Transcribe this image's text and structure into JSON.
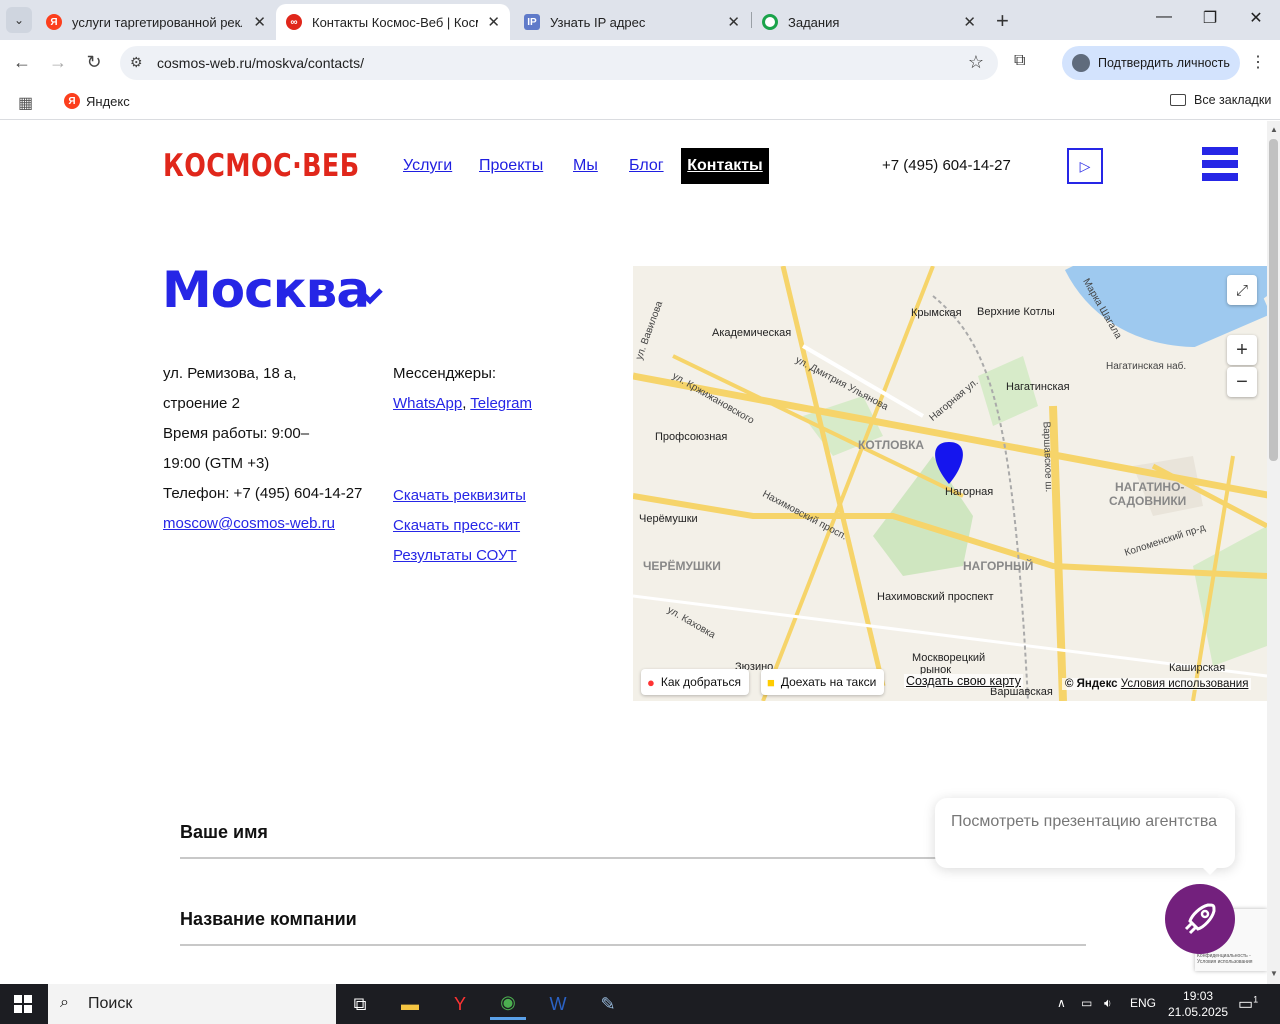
{
  "browser": {
    "tabs": [
      {
        "title": "услуги таргетированной рекла",
        "favicon": "yandex-icon",
        "color": "#fc3f1d",
        "active": false
      },
      {
        "title": "Контакты Космос-Веб | Космо",
        "favicon": "cosmos-web-icon",
        "color": "#e0271b",
        "active": true
      },
      {
        "title": "Узнать IP адрес",
        "favicon": "ip-icon",
        "color": "#5f7ac9",
        "active": false
      },
      {
        "title": "Задания",
        "favicon": "tasks-icon",
        "color": "#1aa34a",
        "active": false
      }
    ],
    "url": "cosmos-web.ru/moskva/contacts/",
    "verify_label": "Подтвердить личность",
    "bookmarks": {
      "yandex": "Яндекс",
      "all": "Все закладки"
    }
  },
  "site": {
    "logo": "КОСМОС·ВЕБ",
    "menu": [
      "Услуги",
      "Проекты",
      "Мы",
      "Блог"
    ],
    "menu_active": "Контакты",
    "phone": "+7 (495) 604-14-27",
    "colors": {
      "brand": "#e0271b",
      "accent": "#2626e6"
    }
  },
  "contacts": {
    "city": "Москва",
    "address_line1": "ул. Ремизова, 18 а,",
    "address_line2": "строение 2",
    "hours_line1": "Время работы: 9:00–",
    "hours_line2": "19:00 (GTM +3)",
    "phone_line": "Телефон: +7 (495) 604-14-27",
    "email": "moscow@cosmos-web.ru",
    "messengers_label": "Мессенджеры:",
    "whatsapp": "WhatsApp",
    "comma": ",",
    "telegram": "Telegram",
    "links": [
      "Скачать реквизиты",
      "Скачать пресс-кит",
      "Результаты СОУТ"
    ]
  },
  "map": {
    "labels": {
      "akademicheskaya": "Академическая",
      "krymskaya": "Крымская",
      "verkhnie_kotly": "Верхние Котлы",
      "nagatinskaya": "Нагатинская",
      "nagatinskaya_nab": "Нагатинская наб.",
      "profsoyuznaya": "Профсоюзная",
      "kotlovka": "КОТЛОВКА",
      "nagornaya": "Нагорная",
      "nagatino": "НАГАТИНО-",
      "sadovniki": "САДОВНИКИ",
      "cheryomushki_st": "Черёмушки",
      "cheryomushki": "ЧЕРЁМУШКИ",
      "nagorny": "НАГОРНЫЙ",
      "nakhimovsky_pr": "Нахимовский просп.",
      "nakhimovsky": "Нахимовский проспект",
      "kolomensky": "Коломенский пр-д",
      "moskvoretsky_1": "Москворецкий",
      "moskvoretsky_2": "рынок",
      "kashirskaya": "Каширская",
      "varshavskaya": "Варшавская",
      "varshavskoe": "Варшавское ш.",
      "dm_ulyanova": "ул. Дмитрия Ульянова",
      "krzhizh": "ул. Кржижановского",
      "kakhovka": "ул. Каховка",
      "nagornaya_ul": "Нагорная ул.",
      "vavilova": "ул. Вавилова",
      "zyuzino": "Зюзино",
      "marka": "Марка Шагала"
    },
    "route_label": "Как добраться",
    "taxi_label": "Доехать на такси",
    "create_label": "Создать свою карту",
    "copyright": "© Яндекс",
    "terms": "Условия использования"
  },
  "form": {
    "name_label": "Ваше имя",
    "company_label": "Название компании"
  },
  "widget": {
    "tooltip": "Посмотреть презентацию агентства",
    "recaptcha": "Конфиденциальность - Условия использования"
  },
  "taskbar": {
    "search": "Поиск",
    "lang": "ENG",
    "time": "19:03",
    "date": "21.05.2025",
    "notifications": "1"
  }
}
